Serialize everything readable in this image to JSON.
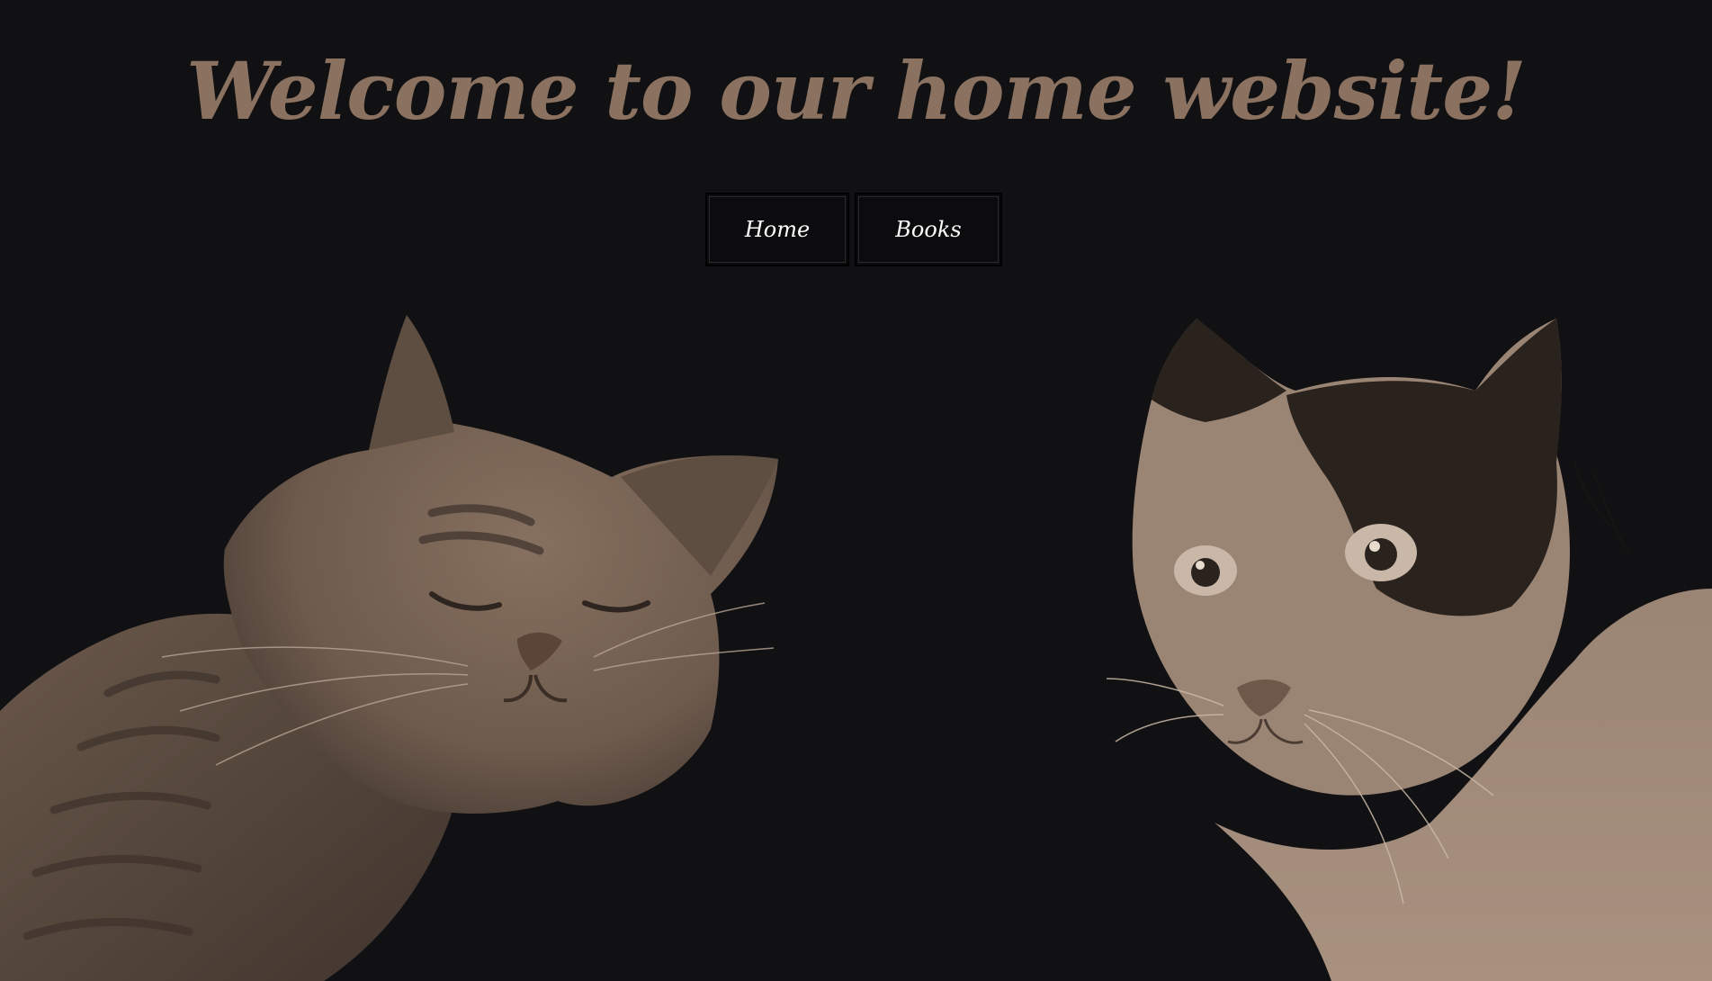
{
  "header": {
    "title": "Welcome to our home website!"
  },
  "nav": {
    "items": [
      {
        "label": "Home"
      },
      {
        "label": "Books"
      }
    ]
  },
  "colors": {
    "background": "#111113",
    "title": "#8b7260",
    "nav_text": "#ffffff",
    "sepia_light": "#8b7260",
    "sepia_dark": "#3a2e26"
  },
  "images": {
    "left": "tabby-cat-photo",
    "right": "black-white-cat-photo"
  }
}
